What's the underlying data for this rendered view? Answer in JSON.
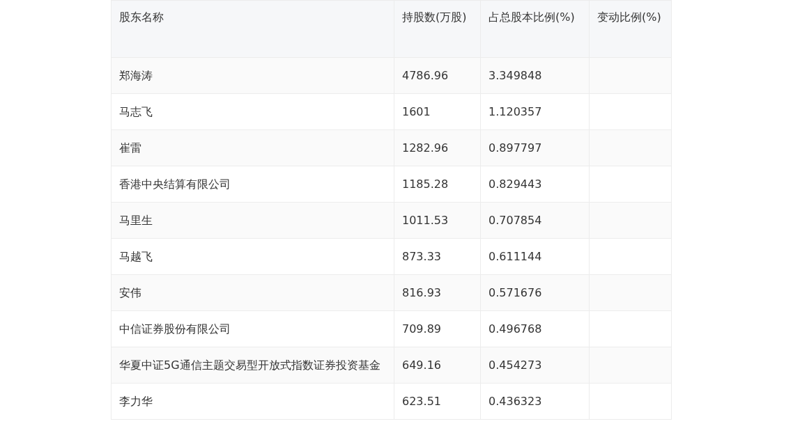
{
  "table": {
    "columns": [
      "股东名称",
      "持股数(万股)",
      "占总股本比例(%)",
      "变动比例(%)"
    ],
    "rows": [
      [
        "郑海涛",
        "4786.96",
        "3.349848",
        ""
      ],
      [
        "马志飞",
        "1601",
        "1.120357",
        ""
      ],
      [
        "崔雷",
        "1282.96",
        "0.897797",
        ""
      ],
      [
        "香港中央结算有限公司",
        "1185.28",
        "0.829443",
        ""
      ],
      [
        "马里生",
        "1011.53",
        "0.707854",
        ""
      ],
      [
        "马越飞",
        "873.33",
        "0.611144",
        ""
      ],
      [
        "安伟",
        "816.93",
        "0.571676",
        ""
      ],
      [
        "中信证券股份有限公司",
        "709.89",
        "0.496768",
        ""
      ],
      [
        "华夏中证5G通信主题交易型开放式指数证券投资基金",
        "649.16",
        "0.454273",
        ""
      ],
      [
        "李力华",
        "623.51",
        "0.436323",
        ""
      ]
    ]
  }
}
